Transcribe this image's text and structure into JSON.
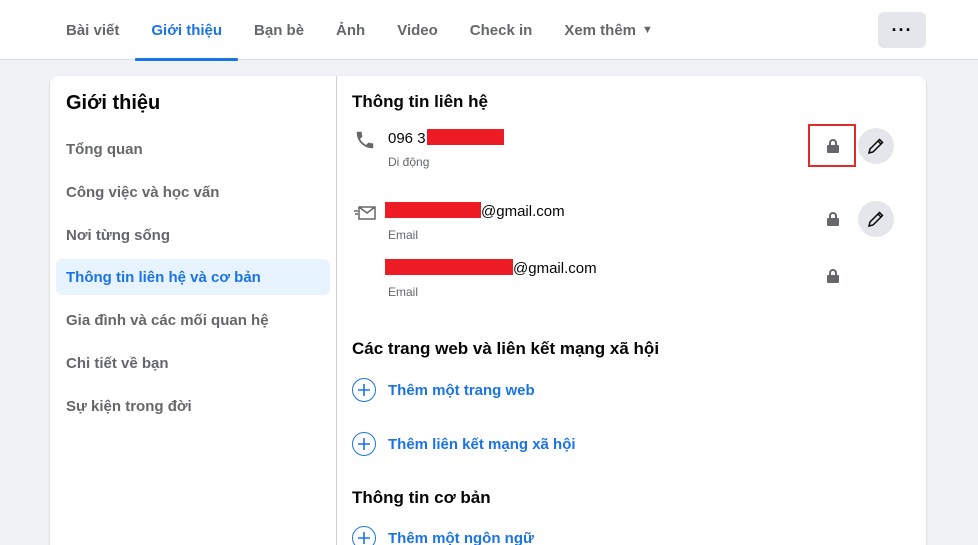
{
  "tabs": [
    {
      "label": "Bài viết"
    },
    {
      "label": "Giới thiệu"
    },
    {
      "label": "Bạn bè"
    },
    {
      "label": "Ảnh"
    },
    {
      "label": "Video"
    },
    {
      "label": "Check in"
    },
    {
      "label": "Xem thêm"
    }
  ],
  "active_tab": "Giới thiệu",
  "more_button_label": "···",
  "sidebar": {
    "title": "Giới thiệu",
    "items": [
      {
        "label": "Tổng quan"
      },
      {
        "label": "Công việc và học vấn"
      },
      {
        "label": "Nơi từng sống"
      },
      {
        "label": "Thông tin liên hệ và cơ bản"
      },
      {
        "label": "Gia đình và các mối quan hệ"
      },
      {
        "label": "Chi tiết về bạn"
      },
      {
        "label": "Sự kiện trong đời"
      }
    ],
    "active_item": "Thông tin liên hệ và cơ bản"
  },
  "contact": {
    "title": "Thông tin liên hệ",
    "phone": {
      "value_prefix": "096 3",
      "type": "Di động",
      "icon": "phone-icon"
    },
    "emails": [
      {
        "value_suffix": "@gmail.com",
        "type": "Email",
        "icon": "email-icon"
      },
      {
        "value_suffix": "@gmail.com",
        "type": "Email"
      }
    ]
  },
  "websites": {
    "title": "Các trang web và liên kết mạng xã hội",
    "add_website": "Thêm một trang web",
    "add_social": "Thêm liên kết mạng xã hội"
  },
  "basic": {
    "title": "Thông tin cơ bản",
    "add_language": "Thêm một ngôn ngữ"
  },
  "colors": {
    "accent": "#1b74e4",
    "redaction": "#ed1c24",
    "highlight": "#e02b2b"
  }
}
